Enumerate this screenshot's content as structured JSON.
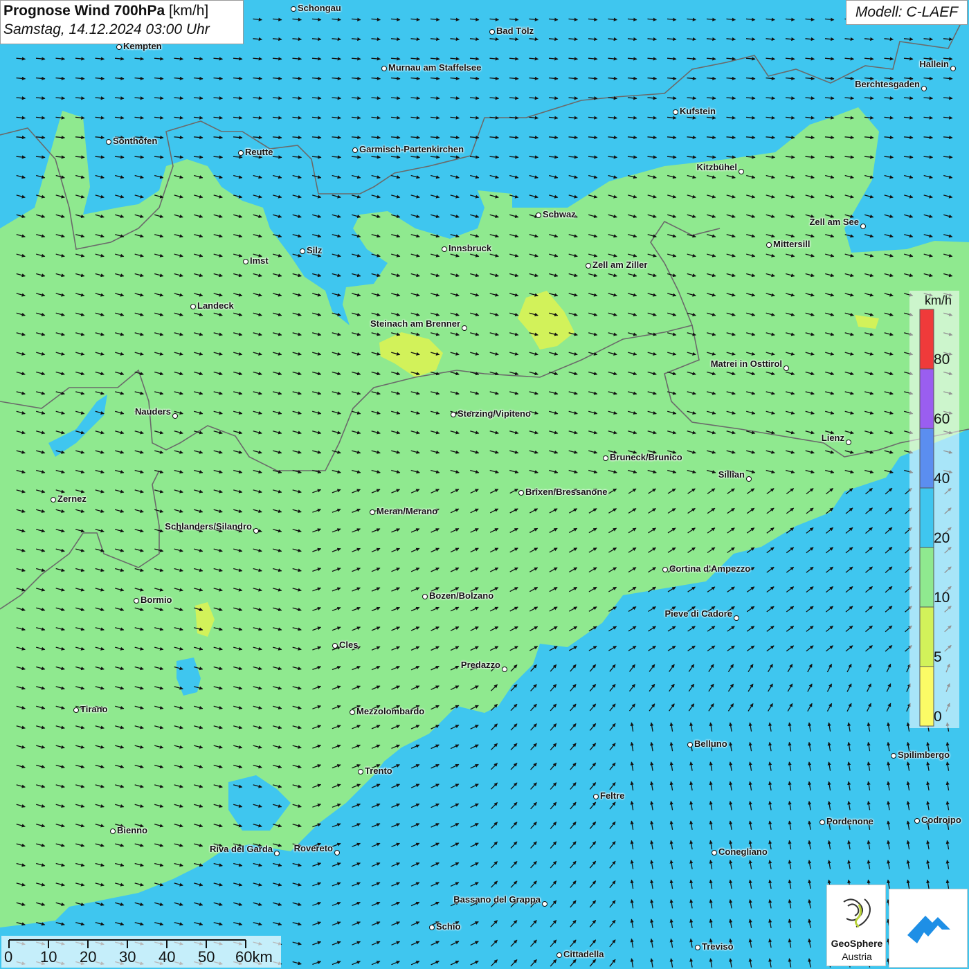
{
  "title": {
    "line1_bold": "Prognose Wind 700hPa",
    "line1_unit": "[km/h]",
    "line2": "Samstag, 14.12.2024 03:00 Uhr"
  },
  "model": "Modell: C-LAEF",
  "colors": {
    "green_10_20": "#8fe98f",
    "cyan_20_40": "#3fc6ef",
    "yellow_0_5": "#e8f56a",
    "border": "#6a6a6a",
    "arrow": "#111111"
  },
  "cities": [
    {
      "name": "Schongau"
    },
    {
      "name": "Bad Tölz"
    },
    {
      "name": "Kempten"
    },
    {
      "name": "Murnau am Staffelsee"
    },
    {
      "name": "Hallein"
    },
    {
      "name": "Berchtesgaden"
    },
    {
      "name": "Kufstein"
    },
    {
      "name": "Sonthofen"
    },
    {
      "name": "Reutte"
    },
    {
      "name": "Garmisch-Partenkirchen"
    },
    {
      "name": "Kitzbühel"
    },
    {
      "name": "Schwaz"
    },
    {
      "name": "Zell am See"
    },
    {
      "name": "Innsbruck"
    },
    {
      "name": "Mittersill"
    },
    {
      "name": "Silz"
    },
    {
      "name": "Imst"
    },
    {
      "name": "Zell am Ziller"
    },
    {
      "name": "Landeck"
    },
    {
      "name": "Steinach am Brenner"
    },
    {
      "name": "Matrei in Osttirol"
    },
    {
      "name": "Nauders"
    },
    {
      "name": "Sterzing/Vipiteno"
    },
    {
      "name": "Lienz"
    },
    {
      "name": "Bruneck/Brunico"
    },
    {
      "name": "Sillian"
    },
    {
      "name": "Brixen/Bressanone"
    },
    {
      "name": "Zernez"
    },
    {
      "name": "Meran/Merano"
    },
    {
      "name": "Schlanders/Silandro"
    },
    {
      "name": "Cortina d'Ampezzo"
    },
    {
      "name": "Bozen/Bolzano"
    },
    {
      "name": "Bormio"
    },
    {
      "name": "Pieve di Cadore"
    },
    {
      "name": "Cles"
    },
    {
      "name": "Predazzo"
    },
    {
      "name": "Tirano"
    },
    {
      "name": "Mezzolombardo"
    },
    {
      "name": "Belluno"
    },
    {
      "name": "Spilimbergo"
    },
    {
      "name": "Trento"
    },
    {
      "name": "Feltre"
    },
    {
      "name": "Pordenone"
    },
    {
      "name": "Codroipo"
    },
    {
      "name": "Bienno"
    },
    {
      "name": "Riva del Garda"
    },
    {
      "name": "Rovereto"
    },
    {
      "name": "Conegliano"
    },
    {
      "name": "Bassano del Grappa"
    },
    {
      "name": "Schio"
    },
    {
      "name": "Treviso"
    },
    {
      "name": "Cittadella"
    }
  ],
  "legend": {
    "unit": "km/h",
    "bins": [
      {
        "label": "0",
        "color": "#fbfb66"
      },
      {
        "label": "5",
        "color": "#d2f25a"
      },
      {
        "label": "10",
        "color": "#8fe98f"
      },
      {
        "label": "20",
        "color": "#3fc6ef"
      },
      {
        "label": "40",
        "color": "#5b8ef0"
      },
      {
        "label": "60",
        "color": "#9a5ef0"
      },
      {
        "label": "80",
        "color": "#ef3a3a"
      }
    ]
  },
  "scalebar": {
    "labels": [
      "0",
      "10",
      "20",
      "30",
      "40",
      "50",
      "60km"
    ]
  },
  "logo": {
    "name": "GeoSphere",
    "sub": "Austria"
  }
}
